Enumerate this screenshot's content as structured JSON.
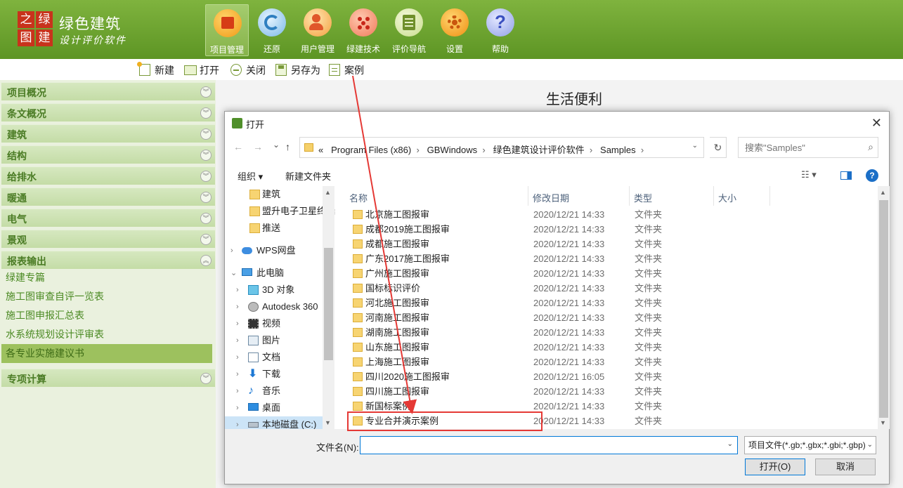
{
  "app": {
    "brand_logo_chars": [
      "之",
      "绿",
      "图",
      "建"
    ],
    "brand_name": "绿色建筑",
    "brand_subtitle": "设计评价软件"
  },
  "toolbar": [
    {
      "label": "项目管理",
      "icon": "project-folder-icon",
      "active": true
    },
    {
      "label": "还原",
      "icon": "restore-icon"
    },
    {
      "label": "用户管理",
      "icon": "user-management-icon"
    },
    {
      "label": "绿建技术",
      "icon": "green-tech-icon"
    },
    {
      "label": "评价导航",
      "icon": "evaluation-nav-icon"
    },
    {
      "label": "设置",
      "icon": "gear-icon"
    },
    {
      "label": "帮助",
      "icon": "help-icon"
    }
  ],
  "subtoolbar": [
    {
      "label": "新建",
      "icon": "new-file-icon"
    },
    {
      "label": "打开",
      "icon": "open-folder-icon"
    },
    {
      "label": "关闭",
      "icon": "close-circle-icon"
    },
    {
      "label": "另存为",
      "icon": "save-as-icon"
    },
    {
      "label": "案例",
      "icon": "case-document-icon"
    }
  ],
  "sidebar": {
    "sections": [
      {
        "label": "项目概况"
      },
      {
        "label": "条文概况"
      },
      {
        "label": "建筑"
      },
      {
        "label": "结构"
      },
      {
        "label": "给排水"
      },
      {
        "label": "暖通"
      },
      {
        "label": "电气"
      },
      {
        "label": "景观"
      },
      {
        "label": "报表输出",
        "expanded": true
      },
      {
        "label": "专项计算"
      }
    ],
    "report_items": [
      {
        "label": "绿建专篇"
      },
      {
        "label": "施工图审查自评一览表"
      },
      {
        "label": "施工图申报汇总表"
      },
      {
        "label": "水系统规划设计评审表"
      },
      {
        "label": "各专业实施建议书",
        "selected": true
      }
    ]
  },
  "main": {
    "title": "生活便利"
  },
  "dialog": {
    "title": "打开",
    "address": {
      "prefix": "«",
      "segments": [
        "Program Files (x86)",
        "GBWindows",
        "绿色建筑设计评价软件",
        "Samples"
      ]
    },
    "search_placeholder": "搜索\"Samples\"",
    "toolbar": {
      "organize": "组织 ▾",
      "new_folder": "新建文件夹"
    },
    "nav": [
      {
        "label": "建筑",
        "icon": "folder-icon",
        "indent": 1
      },
      {
        "label": "盟升电子卫星终端",
        "icon": "folder-icon",
        "indent": 1
      },
      {
        "label": "推送",
        "icon": "folder-icon",
        "indent": 1
      },
      {
        "label": "WPS网盘",
        "icon": "cloud-icon",
        "indent": 0,
        "arrow": "›"
      },
      {
        "label": "此电脑",
        "icon": "computer-icon",
        "indent": 0,
        "arrow": "⌄"
      },
      {
        "label": "3D 对象",
        "icon": "3d-objects-icon",
        "indent": 1,
        "arrow": "›"
      },
      {
        "label": "Autodesk 360",
        "icon": "autodesk-icon",
        "indent": 1,
        "arrow": "›"
      },
      {
        "label": "视频",
        "icon": "video-icon",
        "indent": 1,
        "arrow": "›"
      },
      {
        "label": "图片",
        "icon": "pictures-icon",
        "indent": 1,
        "arrow": "›"
      },
      {
        "label": "文档",
        "icon": "documents-icon",
        "indent": 1,
        "arrow": "›"
      },
      {
        "label": "下载",
        "icon": "download-icon",
        "indent": 1,
        "arrow": "›"
      },
      {
        "label": "音乐",
        "icon": "music-icon",
        "indent": 1,
        "arrow": "›"
      },
      {
        "label": "桌面",
        "icon": "desktop-icon",
        "indent": 1,
        "arrow": "›"
      },
      {
        "label": "本地磁盘 (C:)",
        "icon": "drive-icon",
        "indent": 1,
        "arrow": "›",
        "selected": true
      }
    ],
    "columns": [
      "名称",
      "修改日期",
      "类型",
      "大小"
    ],
    "files": [
      {
        "name": "北京施工图报审",
        "date": "2020/12/21 14:33",
        "type": "文件夹"
      },
      {
        "name": "成都2019施工图报审",
        "date": "2020/12/21 14:33",
        "type": "文件夹"
      },
      {
        "name": "成都施工图报审",
        "date": "2020/12/21 14:33",
        "type": "文件夹"
      },
      {
        "name": "广东2017施工图报审",
        "date": "2020/12/21 14:33",
        "type": "文件夹"
      },
      {
        "name": "广州施工图报审",
        "date": "2020/12/21 14:33",
        "type": "文件夹"
      },
      {
        "name": "国标标识评价",
        "date": "2020/12/21 14:33",
        "type": "文件夹"
      },
      {
        "name": "河北施工图报审",
        "date": "2020/12/21 14:33",
        "type": "文件夹"
      },
      {
        "name": "河南施工图报审",
        "date": "2020/12/21 14:33",
        "type": "文件夹"
      },
      {
        "name": "湖南施工图报审",
        "date": "2020/12/21 14:33",
        "type": "文件夹"
      },
      {
        "name": "山东施工图报审",
        "date": "2020/12/21 14:33",
        "type": "文件夹"
      },
      {
        "name": "上海施工图报审",
        "date": "2020/12/21 14:33",
        "type": "文件夹"
      },
      {
        "name": "四川2020施工图报审",
        "date": "2020/12/21 16:05",
        "type": "文件夹"
      },
      {
        "name": "四川施工图报审",
        "date": "2020/12/21 14:33",
        "type": "文件夹"
      },
      {
        "name": "新国标案例",
        "date": "2020/12/21 14:33",
        "type": "文件夹"
      },
      {
        "name": "专业合并演示案例",
        "date": "2020/12/21 14:33",
        "type": "文件夹",
        "highlighted": true
      }
    ],
    "filename_label": "文件名(N):",
    "filename_value": "",
    "filter_value": "项目文件(*.gb;*.gbx;*.gbi;*.gbp)",
    "open_button": "打开(O)",
    "cancel_button": "取消"
  },
  "colors": {
    "header_green": "#6aa12e",
    "annotation_red": "#e53935",
    "sidebar_bg": "#eaf1de",
    "selected_item": "#9dc15e"
  }
}
